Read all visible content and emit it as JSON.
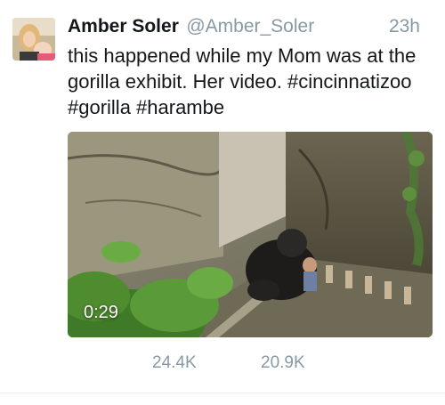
{
  "tweet": {
    "author_name": "Amber Soler",
    "author_handle": "@Amber_Soler",
    "timestamp": "23h",
    "text_lines": [
      "this happened while my Mom was at the",
      "gorilla exhibit.  Her video.  #cincinnatizoo",
      "#gorilla #harambe"
    ],
    "video": {
      "duration": "0:29"
    },
    "stats": {
      "retweets": "24.4K",
      "likes": "20.9K"
    }
  }
}
